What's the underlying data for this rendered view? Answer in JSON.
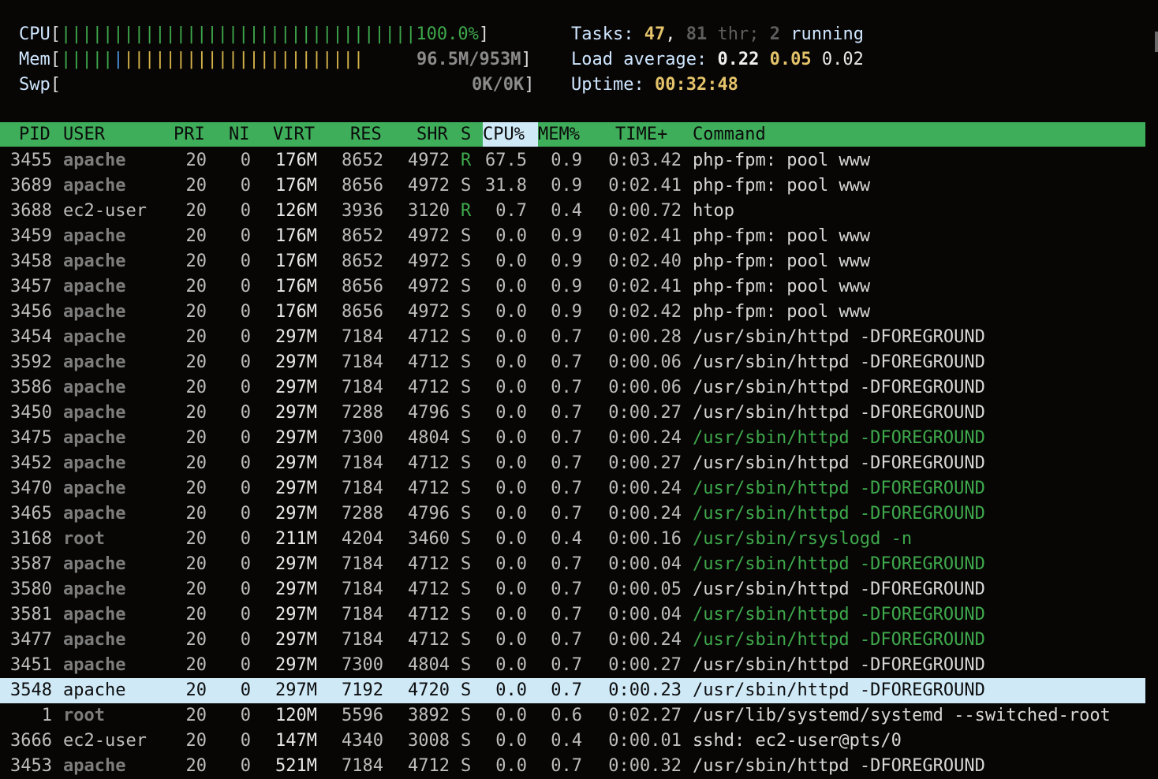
{
  "meters": {
    "cpu": {
      "label": "CPU",
      "bars": "||||||||||||||||||||||||||||||||||",
      "value": "100.0%"
    },
    "mem": {
      "label": "Mem",
      "bars_green": "|||||",
      "bars_blue": "|",
      "bars_yellow": "|||||||||||||||||||||||",
      "value": "96.5M/953M"
    },
    "swp": {
      "label": "Swp",
      "value": "0K/0K"
    }
  },
  "summary": {
    "tasks_label": "Tasks:",
    "tasks_count": "47",
    "threads_count": "81",
    "threads_label": "thr;",
    "running_count": "2",
    "running_label": "running",
    "load_label": "Load average:",
    "load_1": "0.22",
    "load_5": "0.05",
    "load_15": "0.02",
    "uptime_label": "Uptime:",
    "uptime": "00:32:48"
  },
  "columns": {
    "pid": "PID",
    "user": "USER",
    "pri": "PRI",
    "ni": "NI",
    "virt": "VIRT",
    "res": "RES",
    "shr": "SHR",
    "s": "S",
    "cpu": "CPU%",
    "mem": "MEM%",
    "time": "TIME+",
    "command": "Command"
  },
  "sort_column": "CPU%",
  "processes": [
    {
      "pid": "3455",
      "user": "apache",
      "pri": "20",
      "ni": "0",
      "virt": "176M",
      "res": "8652",
      "shr": "4972",
      "s": "R",
      "cpu": "67.5",
      "mem": "0.9",
      "time": "0:03.42",
      "command": "php-fpm: pool www"
    },
    {
      "pid": "3689",
      "user": "apache",
      "pri": "20",
      "ni": "0",
      "virt": "176M",
      "res": "8656",
      "shr": "4972",
      "s": "S",
      "cpu": "31.8",
      "mem": "0.9",
      "time": "0:02.41",
      "command": "php-fpm: pool www"
    },
    {
      "pid": "3688",
      "user": "ec2-user",
      "pri": "20",
      "ni": "0",
      "virt": "126M",
      "res": "3936",
      "shr": "3120",
      "s": "R",
      "cpu": "0.7",
      "mem": "0.4",
      "time": "0:00.72",
      "command": "htop"
    },
    {
      "pid": "3459",
      "user": "apache",
      "pri": "20",
      "ni": "0",
      "virt": "176M",
      "res": "8652",
      "shr": "4972",
      "s": "S",
      "cpu": "0.0",
      "mem": "0.9",
      "time": "0:02.41",
      "command": "php-fpm: pool www"
    },
    {
      "pid": "3458",
      "user": "apache",
      "pri": "20",
      "ni": "0",
      "virt": "176M",
      "res": "8652",
      "shr": "4972",
      "s": "S",
      "cpu": "0.0",
      "mem": "0.9",
      "time": "0:02.40",
      "command": "php-fpm: pool www"
    },
    {
      "pid": "3457",
      "user": "apache",
      "pri": "20",
      "ni": "0",
      "virt": "176M",
      "res": "8656",
      "shr": "4972",
      "s": "S",
      "cpu": "0.0",
      "mem": "0.9",
      "time": "0:02.41",
      "command": "php-fpm: pool www"
    },
    {
      "pid": "3456",
      "user": "apache",
      "pri": "20",
      "ni": "0",
      "virt": "176M",
      "res": "8656",
      "shr": "4972",
      "s": "S",
      "cpu": "0.0",
      "mem": "0.9",
      "time": "0:02.42",
      "command": "php-fpm: pool www"
    },
    {
      "pid": "3454",
      "user": "apache",
      "pri": "20",
      "ni": "0",
      "virt": "297M",
      "res": "7184",
      "shr": "4712",
      "s": "S",
      "cpu": "0.0",
      "mem": "0.7",
      "time": "0:00.28",
      "command": "/usr/sbin/httpd -DFOREGROUND"
    },
    {
      "pid": "3592",
      "user": "apache",
      "pri": "20",
      "ni": "0",
      "virt": "297M",
      "res": "7184",
      "shr": "4712",
      "s": "S",
      "cpu": "0.0",
      "mem": "0.7",
      "time": "0:00.06",
      "command": "/usr/sbin/httpd -DFOREGROUND"
    },
    {
      "pid": "3586",
      "user": "apache",
      "pri": "20",
      "ni": "0",
      "virt": "297M",
      "res": "7184",
      "shr": "4712",
      "s": "S",
      "cpu": "0.0",
      "mem": "0.7",
      "time": "0:00.06",
      "command": "/usr/sbin/httpd -DFOREGROUND"
    },
    {
      "pid": "3450",
      "user": "apache",
      "pri": "20",
      "ni": "0",
      "virt": "297M",
      "res": "7288",
      "shr": "4796",
      "s": "S",
      "cpu": "0.0",
      "mem": "0.7",
      "time": "0:00.27",
      "command": "/usr/sbin/httpd -DFOREGROUND"
    },
    {
      "pid": "3475",
      "user": "apache",
      "pri": "20",
      "ni": "0",
      "virt": "297M",
      "res": "7300",
      "shr": "4804",
      "s": "S",
      "cpu": "0.0",
      "mem": "0.7",
      "time": "0:00.24",
      "command": "/usr/sbin/httpd -DFOREGROUND",
      "thread": true
    },
    {
      "pid": "3452",
      "user": "apache",
      "pri": "20",
      "ni": "0",
      "virt": "297M",
      "res": "7184",
      "shr": "4712",
      "s": "S",
      "cpu": "0.0",
      "mem": "0.7",
      "time": "0:00.27",
      "command": "/usr/sbin/httpd -DFOREGROUND"
    },
    {
      "pid": "3470",
      "user": "apache",
      "pri": "20",
      "ni": "0",
      "virt": "297M",
      "res": "7184",
      "shr": "4712",
      "s": "S",
      "cpu": "0.0",
      "mem": "0.7",
      "time": "0:00.24",
      "command": "/usr/sbin/httpd -DFOREGROUND",
      "thread": true
    },
    {
      "pid": "3465",
      "user": "apache",
      "pri": "20",
      "ni": "0",
      "virt": "297M",
      "res": "7288",
      "shr": "4796",
      "s": "S",
      "cpu": "0.0",
      "mem": "0.7",
      "time": "0:00.24",
      "command": "/usr/sbin/httpd -DFOREGROUND",
      "thread": true
    },
    {
      "pid": "3168",
      "user": "root",
      "pri": "20",
      "ni": "0",
      "virt": "211M",
      "res": "4204",
      "shr": "3460",
      "s": "S",
      "cpu": "0.0",
      "mem": "0.4",
      "time": "0:00.16",
      "command": "/usr/sbin/rsyslogd -n",
      "thread": true
    },
    {
      "pid": "3587",
      "user": "apache",
      "pri": "20",
      "ni": "0",
      "virt": "297M",
      "res": "7184",
      "shr": "4712",
      "s": "S",
      "cpu": "0.0",
      "mem": "0.7",
      "time": "0:00.04",
      "command": "/usr/sbin/httpd -DFOREGROUND",
      "thread": true
    },
    {
      "pid": "3580",
      "user": "apache",
      "pri": "20",
      "ni": "0",
      "virt": "297M",
      "res": "7184",
      "shr": "4712",
      "s": "S",
      "cpu": "0.0",
      "mem": "0.7",
      "time": "0:00.05",
      "command": "/usr/sbin/httpd -DFOREGROUND"
    },
    {
      "pid": "3581",
      "user": "apache",
      "pri": "20",
      "ni": "0",
      "virt": "297M",
      "res": "7184",
      "shr": "4712",
      "s": "S",
      "cpu": "0.0",
      "mem": "0.7",
      "time": "0:00.04",
      "command": "/usr/sbin/httpd -DFOREGROUND",
      "thread": true
    },
    {
      "pid": "3477",
      "user": "apache",
      "pri": "20",
      "ni": "0",
      "virt": "297M",
      "res": "7184",
      "shr": "4712",
      "s": "S",
      "cpu": "0.0",
      "mem": "0.7",
      "time": "0:00.24",
      "command": "/usr/sbin/httpd -DFOREGROUND",
      "thread": true
    },
    {
      "pid": "3451",
      "user": "apache",
      "pri": "20",
      "ni": "0",
      "virt": "297M",
      "res": "7300",
      "shr": "4804",
      "s": "S",
      "cpu": "0.0",
      "mem": "0.7",
      "time": "0:00.27",
      "command": "/usr/sbin/httpd -DFOREGROUND"
    },
    {
      "pid": "3548",
      "user": "apache",
      "pri": "20",
      "ni": "0",
      "virt": "297M",
      "res": "7192",
      "shr": "4720",
      "s": "S",
      "cpu": "0.0",
      "mem": "0.7",
      "time": "0:00.23",
      "command": "/usr/sbin/httpd -DFOREGROUND",
      "selected": true
    },
    {
      "pid": "1",
      "user": "root",
      "pri": "20",
      "ni": "0",
      "virt": "120M",
      "res": "5596",
      "shr": "3892",
      "s": "S",
      "cpu": "0.0",
      "mem": "0.6",
      "time": "0:02.27",
      "command": "/usr/lib/systemd/systemd --switched-root"
    },
    {
      "pid": "3666",
      "user": "ec2-user",
      "pri": "20",
      "ni": "0",
      "virt": "147M",
      "res": "4340",
      "shr": "3008",
      "s": "S",
      "cpu": "0.0",
      "mem": "0.4",
      "time": "0:00.01",
      "command": "sshd: ec2-user@pts/0"
    },
    {
      "pid": "3453",
      "user": "apache",
      "pri": "20",
      "ni": "0",
      "virt": "521M",
      "res": "7184",
      "shr": "4712",
      "s": "S",
      "cpu": "0.0",
      "mem": "0.7",
      "time": "0:00.32",
      "command": "/usr/sbin/httpd -DFOREGROUND"
    }
  ]
}
